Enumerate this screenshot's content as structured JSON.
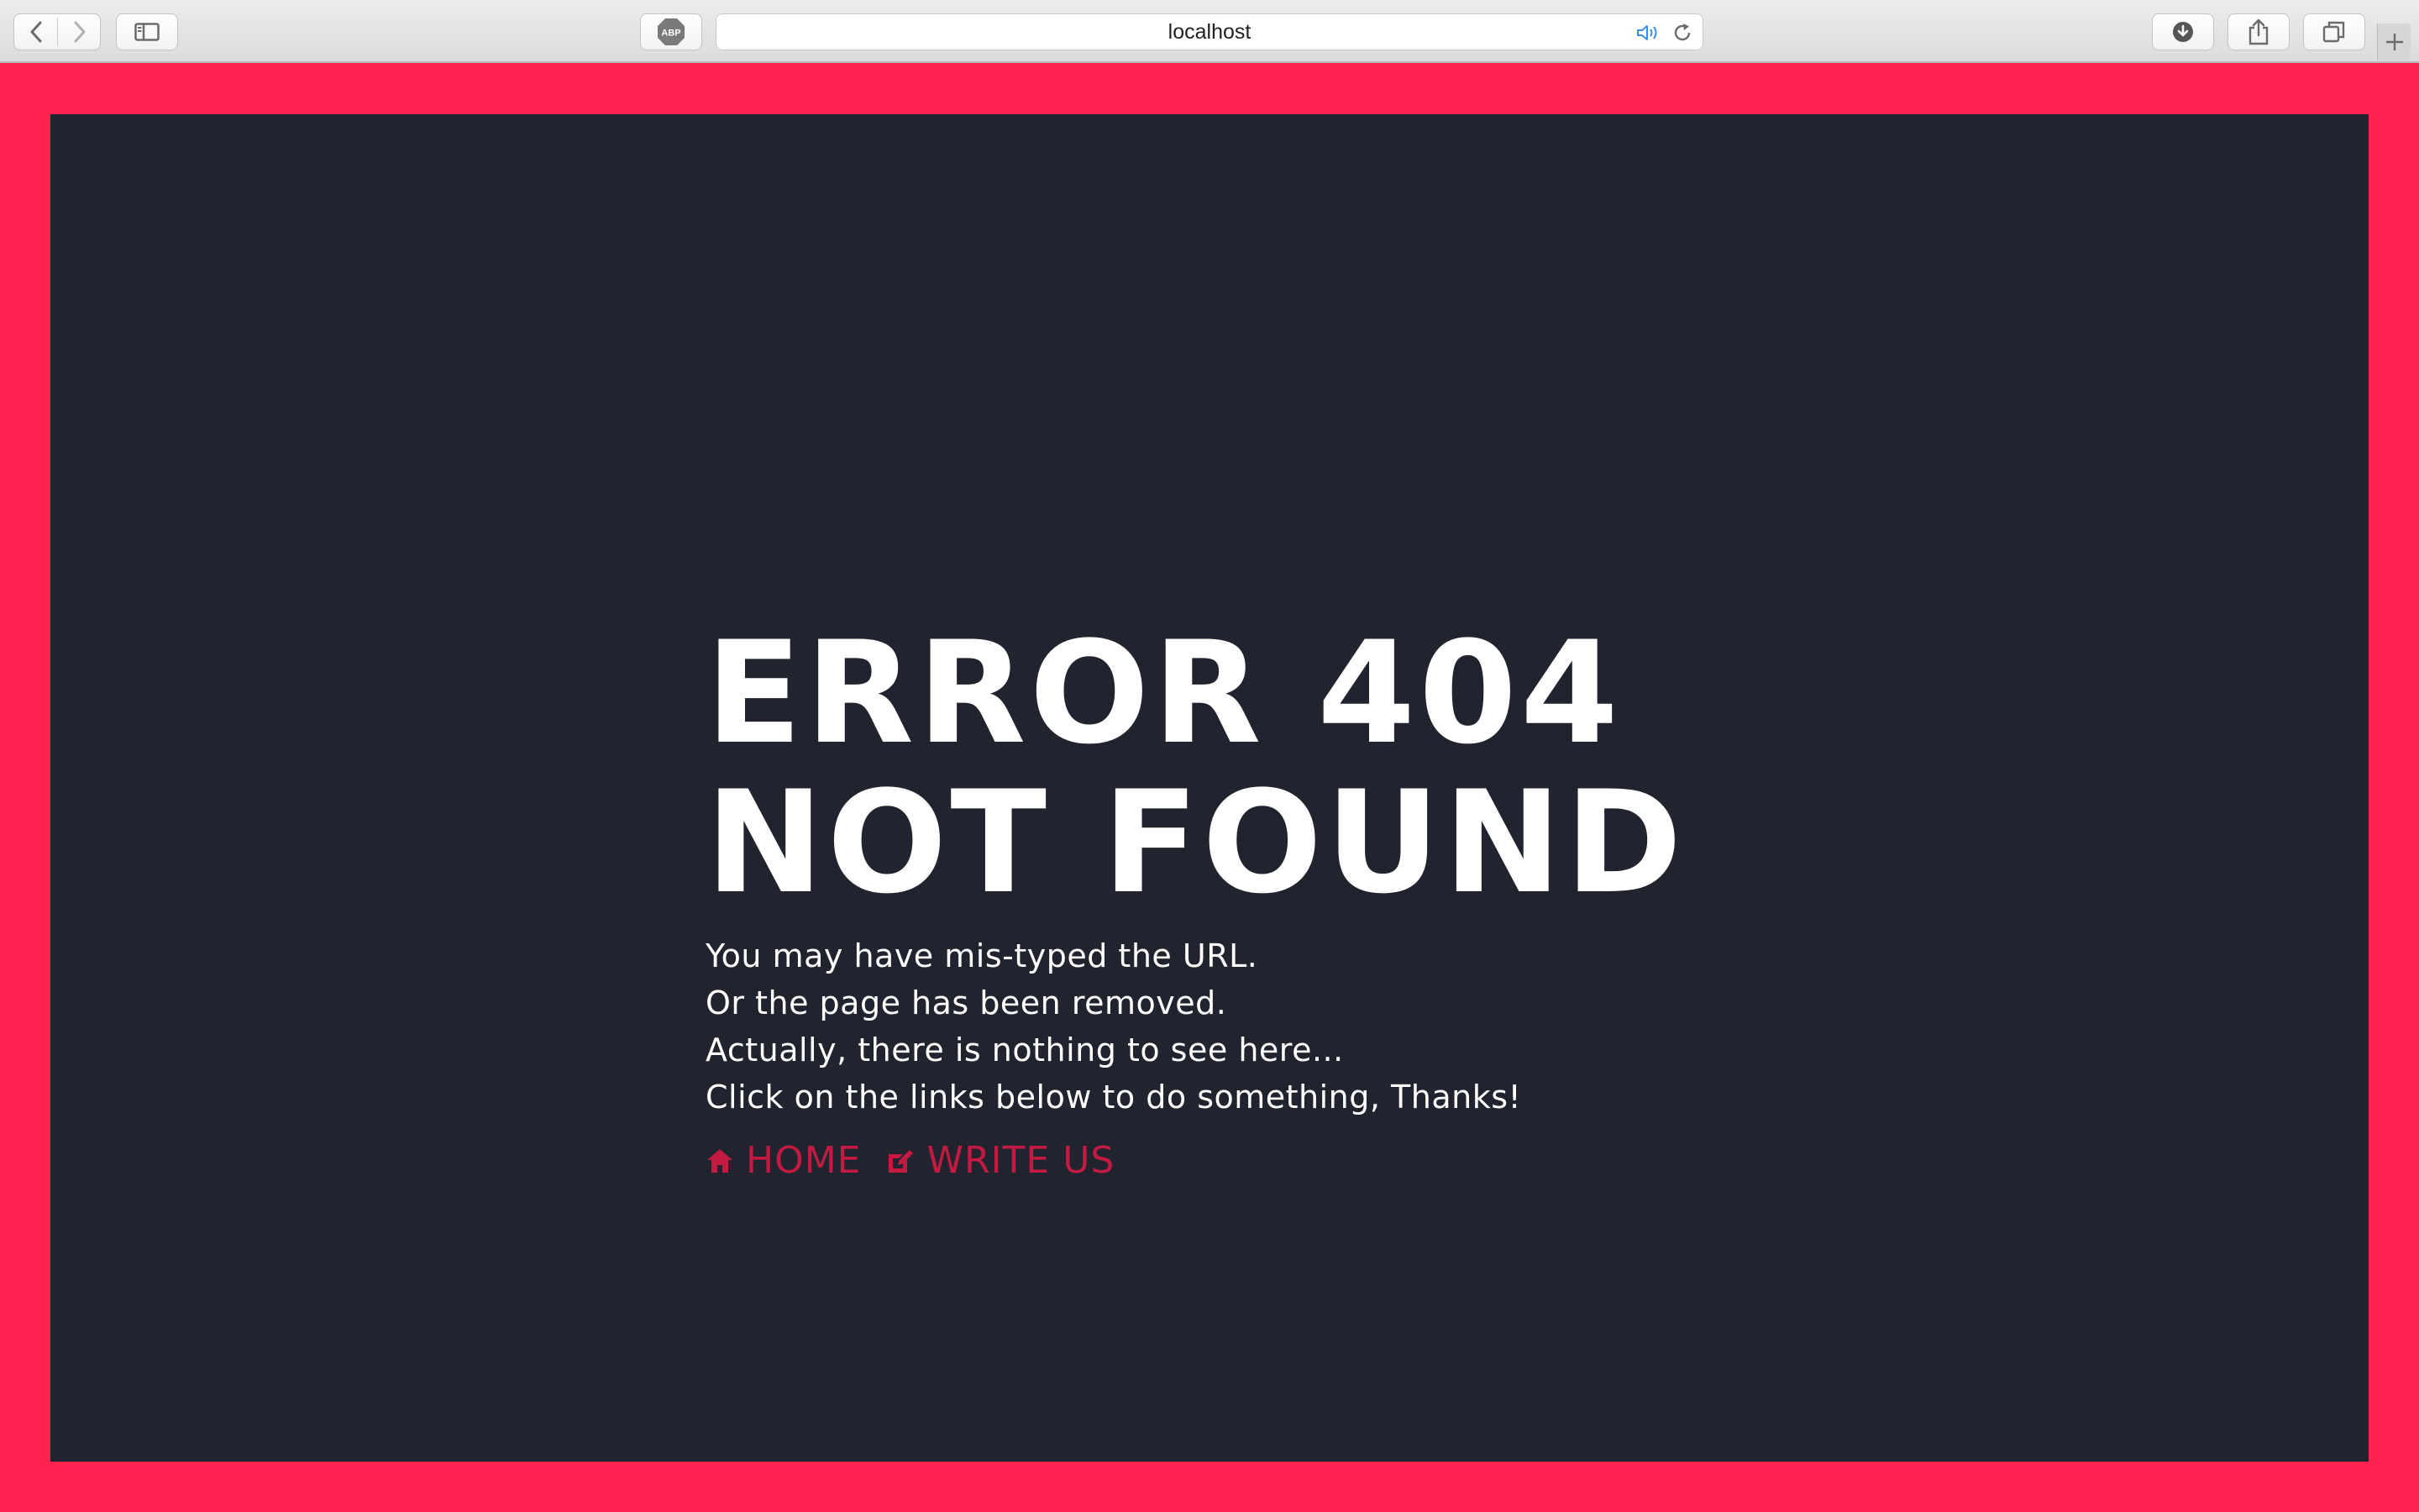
{
  "browser": {
    "url": "localhost",
    "abp_label": "ABP"
  },
  "page": {
    "headline_line1": "ERROR 404",
    "headline_line2": "NOT FOUND",
    "messages": [
      "You may have mis-typed the URL.",
      "Or the page has been removed.",
      "Actually, there is nothing to see here...",
      "Click on the links below to do something, Thanks!"
    ],
    "links": {
      "home_label": "HOME",
      "write_us_label": "WRITE US"
    }
  },
  "colors": {
    "frame": "#ff2350",
    "panel": "#21232f",
    "link": "#c21a40",
    "text": "#ffffff"
  },
  "icons": {
    "home": "home-icon",
    "write_us": "edit-icon"
  }
}
